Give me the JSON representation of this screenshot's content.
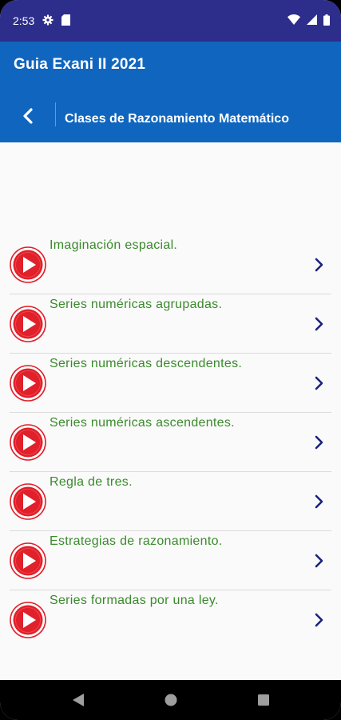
{
  "status": {
    "time": "2:53",
    "icons": [
      "gear-icon",
      "sim-card-icon",
      "wifi-icon",
      "signal-icon",
      "battery-icon"
    ]
  },
  "appbar": {
    "title": "Guia Exani II 2021",
    "subtitle": "Clases de Razonamiento Matemático",
    "back_icon": "chevron-left-icon"
  },
  "lessons": [
    {
      "label": "Imaginación espacial."
    },
    {
      "label": "Series numéricas agrupadas."
    },
    {
      "label": "Series numéricas descendentes."
    },
    {
      "label": "Series numéricas ascendentes."
    },
    {
      "label": "Regla de tres."
    },
    {
      "label": "Estrategias de razonamiento."
    },
    {
      "label": "Series formadas por una ley."
    }
  ],
  "colors": {
    "status_bar": "#2d2d8c",
    "app_bar": "#1066bf",
    "lesson_text": "#3a8a2c",
    "play_red": "#e0202a",
    "chevron": "#1a237e"
  },
  "nav": {
    "icons": [
      "back-triangle-icon",
      "home-circle-icon",
      "recents-square-icon"
    ]
  }
}
